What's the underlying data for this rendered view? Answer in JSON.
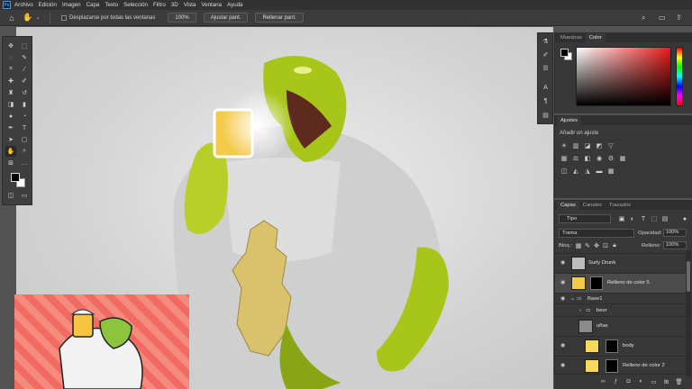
{
  "app": {
    "logo": "Ps"
  },
  "menu": [
    "Archivo",
    "Edición",
    "Imagen",
    "Capa",
    "Texto",
    "Selección",
    "Filtro",
    "3D",
    "Vista",
    "Ventana",
    "Ayuda"
  ],
  "options": {
    "scroll_all_label": "Desplazarse por todas las ventanas",
    "zoom_value": "100%",
    "fit_label": "Ajustar pant.",
    "fill_label": "Rellenar pant."
  },
  "color_panel": {
    "tab_swatches": "Muestras",
    "tab_color": "Color"
  },
  "adjustments": {
    "tab": "Ajustes",
    "hint": "Añadir un ajuste"
  },
  "layers": {
    "tab_layers": "Capas",
    "tab_channels": "Canales",
    "tab_paths": "Trazados",
    "filter_kind": "Tipo",
    "blend_mode": "Trama",
    "opacity_label": "Opacidad:",
    "opacity_value": "100%",
    "lock_label": "Bloq.:",
    "fill_label": "Relleno:",
    "fill_value": "100%",
    "items": [
      {
        "name": "Surly Drunk",
        "kind": "pixel",
        "selected": false
      },
      {
        "name": "Relleno de color 5",
        "kind": "fill",
        "selected": true
      },
      {
        "name": "Base1",
        "kind": "group",
        "selected": false
      },
      {
        "name": "beer",
        "kind": "group",
        "selected": false
      },
      {
        "name": "uñas",
        "kind": "pixel",
        "selected": false
      },
      {
        "name": "body",
        "kind": "fill",
        "selected": false
      },
      {
        "name": "Relleno de color 2",
        "kind": "fill",
        "selected": false
      }
    ]
  },
  "colors": {
    "foreground": "#000000",
    "background": "#ffffff",
    "fill_yellow": "#f3c94a",
    "creature_green": "#a8c61a"
  }
}
